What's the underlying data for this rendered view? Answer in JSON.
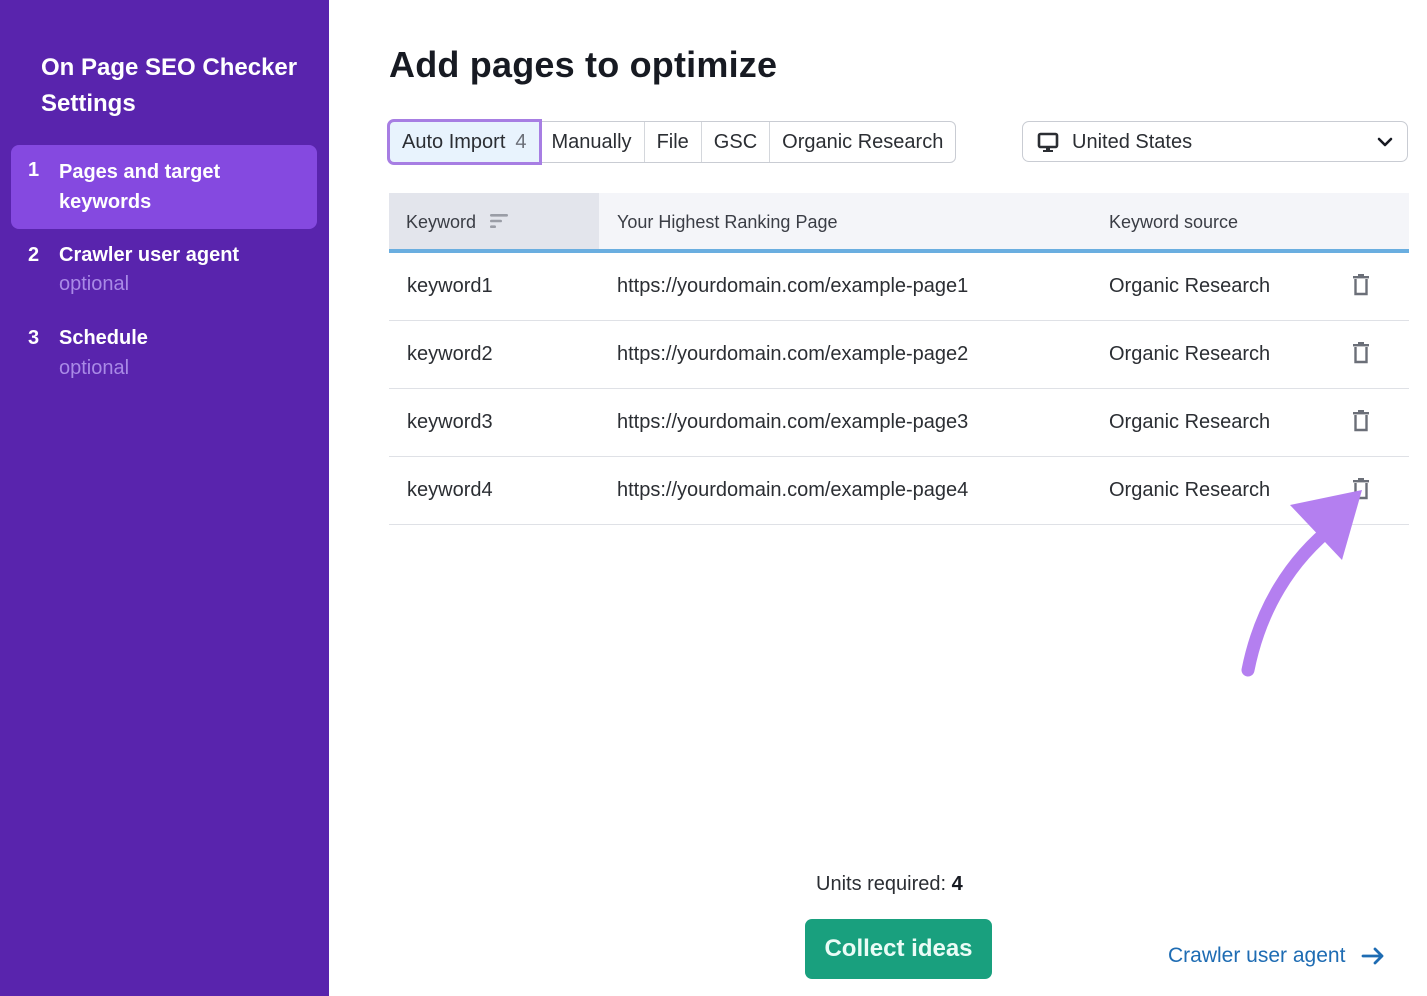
{
  "sidebar": {
    "title": "On Page SEO Checker Settings",
    "steps": [
      {
        "num": "1",
        "label": "Pages and target keywords",
        "sub": "",
        "active": true
      },
      {
        "num": "2",
        "label": "Crawler user agent",
        "sub": "optional",
        "active": false
      },
      {
        "num": "3",
        "label": "Schedule",
        "sub": "optional",
        "active": false
      }
    ]
  },
  "main": {
    "title": "Add pages to optimize",
    "tabs": [
      {
        "label": "Auto Import",
        "count": "4",
        "active": true
      },
      {
        "label": "Manually"
      },
      {
        "label": "File"
      },
      {
        "label": "GSC"
      },
      {
        "label": "Organic Research"
      }
    ],
    "country": {
      "icon": "desktop-icon",
      "value": "United States"
    },
    "table": {
      "columns": [
        "Keyword",
        "Your Highest Ranking Page",
        "Keyword source"
      ],
      "rows": [
        {
          "keyword": "keyword1",
          "page": "https://yourdomain.com/example-page1",
          "source": "Organic Research"
        },
        {
          "keyword": "keyword2",
          "page": "https://yourdomain.com/example-page2",
          "source": "Organic Research"
        },
        {
          "keyword": "keyword3",
          "page": "https://yourdomain.com/example-page3",
          "source": "Organic Research"
        },
        {
          "keyword": "keyword4",
          "page": "https://yourdomain.com/example-page4",
          "source": "Organic Research"
        }
      ]
    },
    "units_label": "Units required:",
    "units_value": "4",
    "collect_button": "Collect ideas",
    "next_link": "Crawler user agent"
  },
  "colors": {
    "sidebar_bg": "#5924ad",
    "active_step_bg": "#8549e0",
    "primary_button": "#19a07e",
    "link": "#1e6cb3",
    "annotation_arrow": "#b47ff0"
  }
}
